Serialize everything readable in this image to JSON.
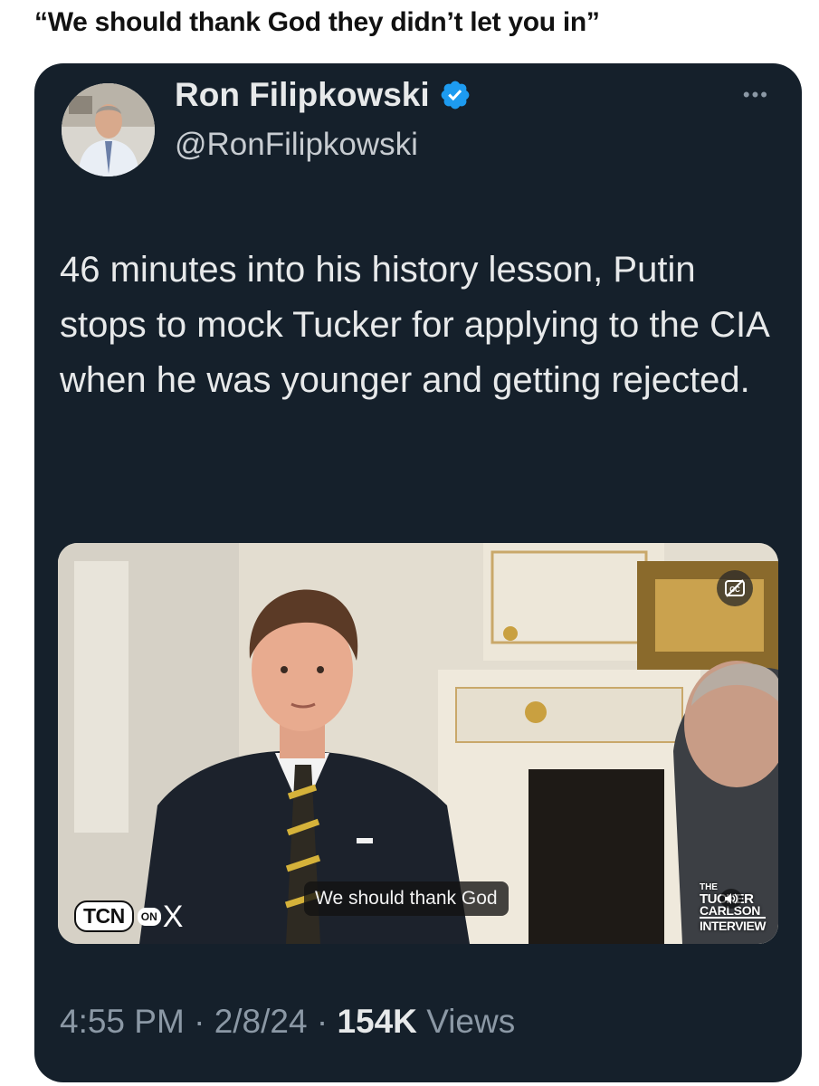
{
  "caption": "“We should thank God they didn’t let you in”",
  "tweet": {
    "display_name": "Ron Filipkowski",
    "handle": "@RonFilipkowski",
    "text": "46 minutes into his history lesson, Putin stops to mock Tucker for applying to the CIA when he was younger and getting rejected.",
    "time": "4:55 PM",
    "date": "2/8/24",
    "views_count": "154K",
    "views_label": "Views",
    "more_glyph": "•••",
    "separator": "·"
  },
  "media": {
    "subtitle": "We should thank God",
    "logo": {
      "tcn": "TCN",
      "on": "ON",
      "x": "X"
    },
    "watermark": [
      "THE",
      "TUCKER",
      "CARLSON",
      "INTERVIEW"
    ],
    "icons": [
      "closed-captions-icon",
      "speaker-muted-icon"
    ]
  },
  "colors": {
    "card_bg": "#15202b",
    "primary_text": "#e7e9ea",
    "secondary_text": "#8b98a5",
    "verified_blue": "#1d9bf0"
  }
}
